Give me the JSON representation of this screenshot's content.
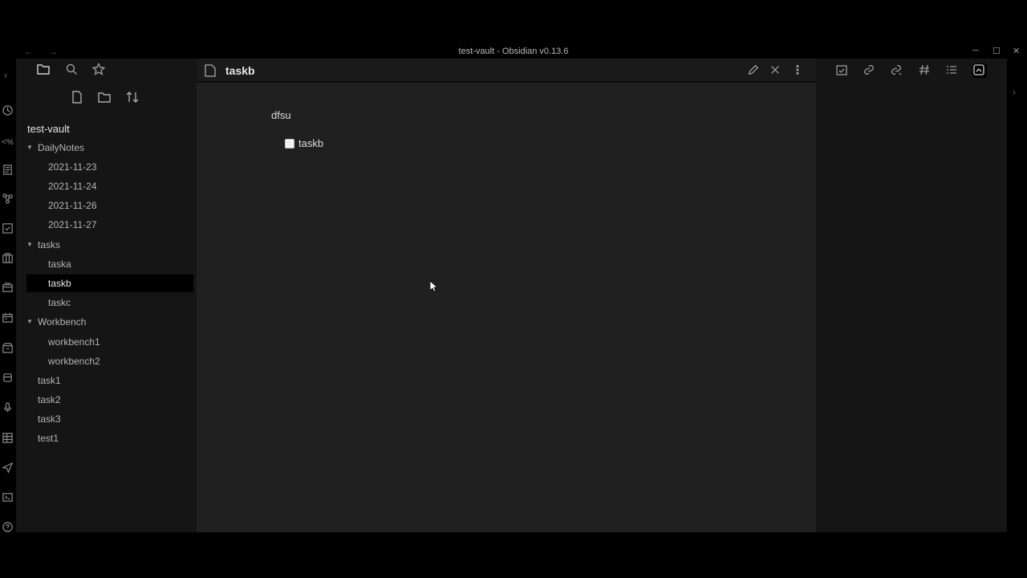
{
  "window": {
    "title": "test-vault - Obsidian v0.13.6",
    "nav_back": "←",
    "nav_forward": "→",
    "minimize": "─",
    "maximize": "☐",
    "close": "✕"
  },
  "ribbon": {
    "collapse_label": "‹",
    "icons": [
      "daily-note-icon",
      "templater-icon",
      "template-icon",
      "graph-icon",
      "tasks-icon",
      "kanban-icon",
      "card-icon",
      "calendar-icon",
      "archive-icon",
      "dice-icon",
      "microphone-icon",
      "table-icon",
      "send-icon",
      "terminal-icon",
      "help-icon"
    ]
  },
  "left_sidebar": {
    "tabs": [
      "file-explorer-icon",
      "search-icon",
      "star-icon"
    ],
    "actions": [
      "new-note-icon",
      "new-folder-icon",
      "sort-icon"
    ],
    "vault_name": "test-vault",
    "tree": [
      {
        "label": "DailyNotes",
        "type": "folder",
        "expanded": true
      },
      {
        "label": "2021-11-23",
        "type": "file",
        "depth": 1
      },
      {
        "label": "2021-11-24",
        "type": "file",
        "depth": 1
      },
      {
        "label": "2021-11-26",
        "type": "file",
        "depth": 1
      },
      {
        "label": "2021-11-27",
        "type": "file",
        "depth": 1
      },
      {
        "label": "tasks",
        "type": "folder",
        "expanded": true
      },
      {
        "label": "taska",
        "type": "file",
        "depth": 1
      },
      {
        "label": "taskb",
        "type": "file",
        "depth": 1,
        "active": true
      },
      {
        "label": "taskc",
        "type": "file",
        "depth": 1
      },
      {
        "label": "Workbench",
        "type": "folder",
        "expanded": true
      },
      {
        "label": "workbench1",
        "type": "file",
        "depth": 1
      },
      {
        "label": "workbench2",
        "type": "file",
        "depth": 1
      },
      {
        "label": "task1",
        "type": "file",
        "depth": 0
      },
      {
        "label": "task2",
        "type": "file",
        "depth": 0
      },
      {
        "label": "task3",
        "type": "file",
        "depth": 0
      },
      {
        "label": "test1",
        "type": "file",
        "depth": 0
      }
    ]
  },
  "editor": {
    "title": "taskb",
    "actions": [
      "edit-icon",
      "close-icon",
      "more-options-icon"
    ],
    "content": {
      "line1": "dfsu",
      "task_label": "taskb",
      "task_checked": false
    }
  },
  "right_sidebar": {
    "tabs": [
      "calendar-check-icon",
      "outgoing-links-icon",
      "backlinks-icon",
      "tags-icon",
      "outline-icon",
      "review-icon"
    ],
    "active_tab": "review-icon",
    "expand_label": "›"
  },
  "colors": {
    "background": "#000000",
    "sidebar": "#151515",
    "editor": "#202020",
    "active_item": "#000000",
    "text": "#dcddde"
  }
}
